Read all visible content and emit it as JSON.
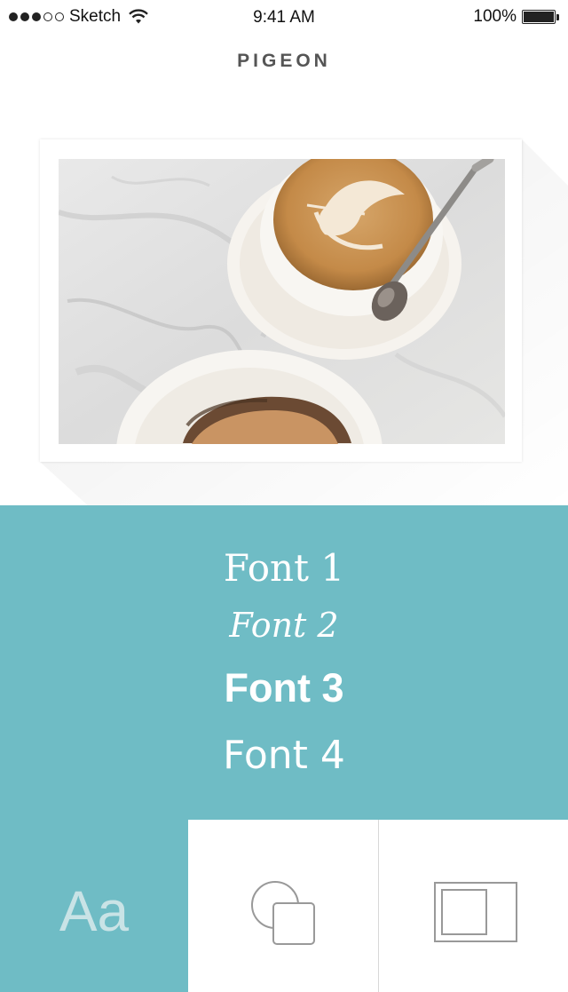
{
  "status_bar": {
    "carrier": "Sketch",
    "time": "9:41 AM",
    "battery": "100%",
    "signal_icon": "signal-dots-icon",
    "wifi_icon": "wifi-icon",
    "battery_icon": "battery-icon"
  },
  "header": {
    "title": "PIGEON"
  },
  "photo": {
    "description_icon": "photo"
  },
  "fonts": {
    "options": [
      "Font 1",
      "Font 2",
      "Font 3",
      "Font 4"
    ]
  },
  "toolbar": {
    "text_tool_label": "Aa",
    "shapes_icon": "shapes-icon",
    "frame_icon": "frame-icon"
  },
  "colors": {
    "accent": "#6fbcc5",
    "title": "#555555",
    "tool_icon": "#999999"
  }
}
